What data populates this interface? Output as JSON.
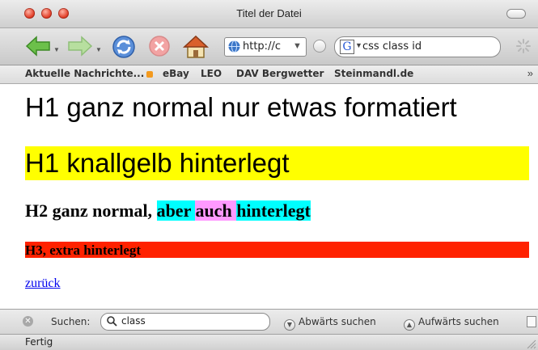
{
  "window": {
    "title": "Titel der Datei"
  },
  "toolbar": {
    "url_text": "http://c",
    "search_text": "css class id"
  },
  "bookmarks": {
    "items": [
      {
        "label": "Aktuelle Nachrichte..."
      },
      {
        "label": "eBay"
      },
      {
        "label": "LEO"
      },
      {
        "label": "DAV Bergwetter"
      },
      {
        "label": "Steinmandl.de"
      }
    ],
    "overflow": "»"
  },
  "content": {
    "h1_plain": "H1 ganz normal nur etwas formatiert",
    "h1_yellow": "H1 knallgelb hinterlegt",
    "h2_part1": "H2 ganz normal, ",
    "h2_part2": "aber ",
    "h2_part3": "auch ",
    "h2_part4": "hinterlegt",
    "h3": "H3, extra hinterlegt",
    "back_link": "zurück"
  },
  "findbar": {
    "label": "Suchen:",
    "query": "class",
    "down_label": "Abwärts suchen",
    "up_label": "Aufwärts suchen"
  },
  "statusbar": {
    "text": "Fertig"
  },
  "colors": {
    "h1_highlight": "#ffff00",
    "h2_cyan": "#00ffff",
    "h2_pink": "#ff99ff",
    "h3_highlight": "#ff2200",
    "link": "#0000ee"
  },
  "icons": [
    "back-arrow-icon",
    "forward-arrow-icon",
    "reload-icon",
    "stop-icon",
    "home-icon",
    "globe-icon",
    "google-icon",
    "spinner-icon",
    "rss-icon",
    "close-icon",
    "magnifier-icon",
    "resize-grip-icon"
  ]
}
